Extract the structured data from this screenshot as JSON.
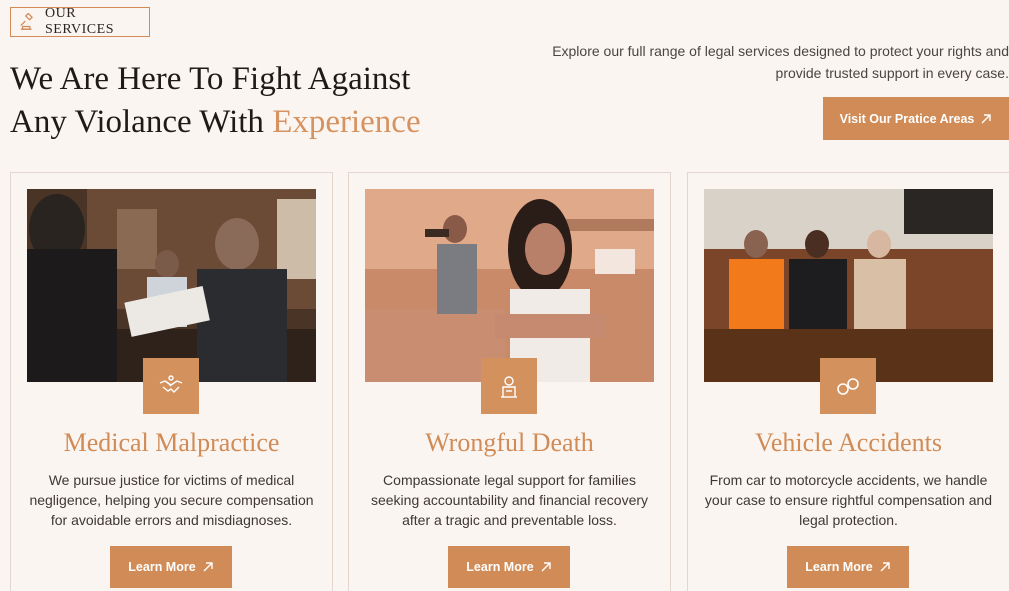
{
  "header": {
    "eyebrow": "OUR SERVICES",
    "headline_line1": "We Are Here To Fight Against",
    "headline_line2_prefix": "Any Violance With ",
    "headline_accent": "Experience",
    "intro_line1": "Explore our full range of legal services designed to protect your rights and",
    "intro_line2": "provide trusted support in every case.",
    "cta_label": "Visit Our Pratice Areas"
  },
  "cards": [
    {
      "title": "Medical Malpractice",
      "description": "We pursue justice for victims of medical negligence, helping you secure compensation for avoidable errors and misdiagnoses.",
      "button": "Learn More",
      "icon": "handshake-icon"
    },
    {
      "title": "Wrongful Death",
      "description": "Compassionate legal support for families seeking accountability and financial recovery after a tragic and preventable loss.",
      "button": "Learn More",
      "icon": "memorial-icon"
    },
    {
      "title": "Vehicle Accidents",
      "description": "From car to motorcycle accidents, we handle your case to ensure rightful compensation and legal protection.",
      "button": "Learn More",
      "icon": "handcuffs-icon"
    }
  ],
  "colors": {
    "accent": "#d08b56",
    "background": "#fbf5f1",
    "heading": "#1e1a18"
  }
}
